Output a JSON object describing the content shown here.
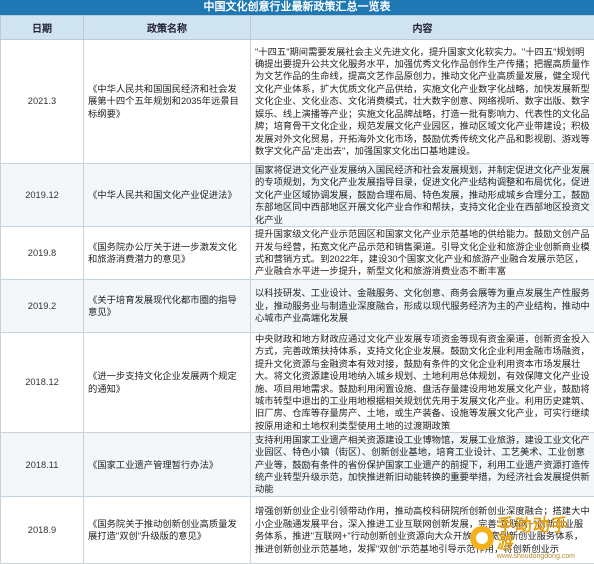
{
  "title": "中国文化创意行业最新政策汇总一览表",
  "headers": {
    "date": "日期",
    "name": "政策名称",
    "content": "内容"
  },
  "rows": [
    {
      "date": "2021.3",
      "name": "《中华人民共和国国民经济和社会发展第十四个五年规划和2035年远景目标纲要》",
      "content": "\"十四五\"期间需要发展社会主义先进文化，提升国家文化软实力。\"十四五\"规划明确提出要提升公共文化服务水平，加强优秀文化作品创作生产传播；把握高质量作为文艺作品的生命线，提高文艺作品原创力，推动文化产业高质量发展，健全现代文化产业体系，扩大优质文化产品供给，实施文化产业数字化战略，加快发展新型文化企业、文化业态、文化消费模式，壮大数字创意、网络视听、数字出版、数字娱乐、线上演播等产业；实施文化品牌战略，打造一批有影响力、代表性的文化品牌；培育骨干文化企业，规范发展文化产业园区，推动区域文化产业带建设；积极发展对外文化贸易，开拓海外文化市场，鼓励优秀传统文化产品和影视剧、游戏等数字文化产品\"走出去\"，加强国家文化出口基地建设。"
    },
    {
      "date": "2019.12",
      "name": "《中华人民共和国文化产业促进法》",
      "content": "国家将促进文化产业发展纳入国民经济和社会发展规划，并制定促进文化产业发展的专项规划，为文化产业发展指导目录，促进文化产业结构调整和布局优化，促进文化产业区域协调发展，鼓励合理布局、特色发展，推动形成城乡合理分工，鼓励东部地区同中西部地区开展文化产业合作和帮扶，支持文化企业在西部地区投资文化产业"
    },
    {
      "date": "2019.8",
      "name": "《国务院办公厅关于进一步激发文化和旅游消费潜力的意见》",
      "content": "提升国家级文化产业示范园区和国家文化产业示范基地的供给能力。鼓励文创产品开发与经营，拓宽文化产品示范和销售渠道。引导文化企业和旅游企业创新商业模式和营销方式。到2022年，建设30个国家文化产业和旅游产业融合发展示范区，产业融合水平进一步提升，新型文化和旅游消费业态不断丰富"
    },
    {
      "date": "2019.2",
      "name": "《关于培育发展现代化都市圈的指导意见》",
      "content": "以科技研发、工业设计、金融服务、文化创意、商务会展等为重点发展生产性服务业，推动服务业与制造业深度融合，形成以现代服务经济为主的产业结构，推动中心城市产业高端化发展"
    },
    {
      "date": "2018.12",
      "name": "《进一步支持文化企业发展两个规定的通知》",
      "content": "中央财政和地方财政应通过文化产业发展专项资金等现有资金渠道，创新资金投入方式，完善政策扶持体系，支持文化企业发展。鼓励文化企业利用金融市场融资，提升文化资源与金融资本有效对接，鼓励有条件的文化企业利用资本市场发展壮大。将文化资源建设用地纳入城乡规划、土地利用总体规划，有效保障文化产业设施、项目用地需求。鼓励利用闲置设施、盘活存量建设用地发展文化产业，鼓励将城市转型中退出的工业用地根据相关规划优先用于发展文化产业。利用历史建筑、旧厂房、仓库等存量房产、土地，或生产装备、设施等发展文化产业，可实行继续按原用途和土地权利类型使用土地的过渡期政策"
    },
    {
      "date": "2018.11",
      "name": "《国家工业遗产管理暂行办法》",
      "content": "支持利用国家工业遗产相关资源建设工业博物馆，发展工业旅游，建设工业文化产业园区、特色小镇（街区）、创新创业基地，培育工业设计、工艺美术、工业创意产业等，鼓励有条件的省份保护国家工业遗产的前提下，利用工业遗产资源打造传统产业转型升级示范，加快推进新旧动能转换的重要举措，为经济社会发展提供新动能"
    },
    {
      "date": "2018.9",
      "name": "《国务院关于推动创新创业高质量发展打造\"双创\"升级版的意见》",
      "content": "增强创新创业企业引领带动作用，推动高校科研院所创新创业深度融合；搭建大中小企业融通发展平台，深入推进工业互联网创新发展，完善\"互联网+\"创新创业服务体系，推进\"互联网+\"行动创新创业资源向大众开放，拓宽创新创业服务体系，推进创新创业示范基地，发挥\"双创\"示范基地引导示范作用，将创新创业示"
    }
  ],
  "watermark": {
    "text": "手动动手游",
    "url": "www.shoudongdong.com"
  }
}
